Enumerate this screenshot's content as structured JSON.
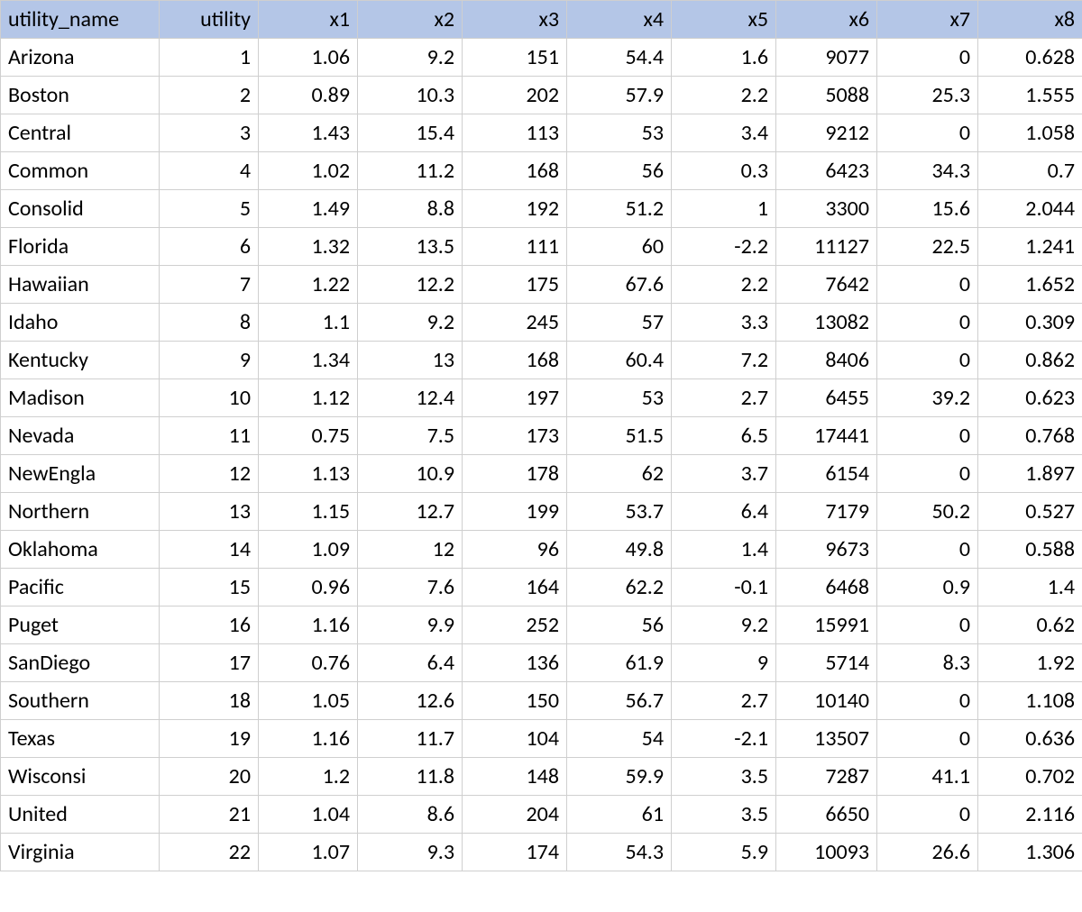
{
  "columns": [
    "utility_name",
    "utility",
    "x1",
    "x2",
    "x3",
    "x4",
    "x5",
    "x6",
    "x7",
    "x8"
  ],
  "rows": [
    {
      "utility_name": "Arizona",
      "utility": "1",
      "x1": "1.06",
      "x2": "9.2",
      "x3": "151",
      "x4": "54.4",
      "x5": "1.6",
      "x6": "9077",
      "x7": "0",
      "x8": "0.628"
    },
    {
      "utility_name": "Boston",
      "utility": "2",
      "x1": "0.89",
      "x2": "10.3",
      "x3": "202",
      "x4": "57.9",
      "x5": "2.2",
      "x6": "5088",
      "x7": "25.3",
      "x8": "1.555"
    },
    {
      "utility_name": "Central",
      "utility": "3",
      "x1": "1.43",
      "x2": "15.4",
      "x3": "113",
      "x4": "53",
      "x5": "3.4",
      "x6": "9212",
      "x7": "0",
      "x8": "1.058"
    },
    {
      "utility_name": "Common",
      "utility": "4",
      "x1": "1.02",
      "x2": "11.2",
      "x3": "168",
      "x4": "56",
      "x5": "0.3",
      "x6": "6423",
      "x7": "34.3",
      "x8": "0.7"
    },
    {
      "utility_name": "Consolid",
      "utility": "5",
      "x1": "1.49",
      "x2": "8.8",
      "x3": "192",
      "x4": "51.2",
      "x5": "1",
      "x6": "3300",
      "x7": "15.6",
      "x8": "2.044"
    },
    {
      "utility_name": "Florida",
      "utility": "6",
      "x1": "1.32",
      "x2": "13.5",
      "x3": "111",
      "x4": "60",
      "x5": "-2.2",
      "x6": "11127",
      "x7": "22.5",
      "x8": "1.241"
    },
    {
      "utility_name": "Hawaiian",
      "utility": "7",
      "x1": "1.22",
      "x2": "12.2",
      "x3": "175",
      "x4": "67.6",
      "x5": "2.2",
      "x6": "7642",
      "x7": "0",
      "x8": "1.652"
    },
    {
      "utility_name": "Idaho",
      "utility": "8",
      "x1": "1.1",
      "x2": "9.2",
      "x3": "245",
      "x4": "57",
      "x5": "3.3",
      "x6": "13082",
      "x7": "0",
      "x8": "0.309"
    },
    {
      "utility_name": "Kentucky",
      "utility": "9",
      "x1": "1.34",
      "x2": "13",
      "x3": "168",
      "x4": "60.4",
      "x5": "7.2",
      "x6": "8406",
      "x7": "0",
      "x8": "0.862"
    },
    {
      "utility_name": "Madison",
      "utility": "10",
      "x1": "1.12",
      "x2": "12.4",
      "x3": "197",
      "x4": "53",
      "x5": "2.7",
      "x6": "6455",
      "x7": "39.2",
      "x8": "0.623"
    },
    {
      "utility_name": "Nevada",
      "utility": "11",
      "x1": "0.75",
      "x2": "7.5",
      "x3": "173",
      "x4": "51.5",
      "x5": "6.5",
      "x6": "17441",
      "x7": "0",
      "x8": "0.768"
    },
    {
      "utility_name": "NewEngla",
      "utility": "12",
      "x1": "1.13",
      "x2": "10.9",
      "x3": "178",
      "x4": "62",
      "x5": "3.7",
      "x6": "6154",
      "x7": "0",
      "x8": "1.897"
    },
    {
      "utility_name": "Northern",
      "utility": "13",
      "x1": "1.15",
      "x2": "12.7",
      "x3": "199",
      "x4": "53.7",
      "x5": "6.4",
      "x6": "7179",
      "x7": "50.2",
      "x8": "0.527"
    },
    {
      "utility_name": "Oklahoma",
      "utility": "14",
      "x1": "1.09",
      "x2": "12",
      "x3": "96",
      "x4": "49.8",
      "x5": "1.4",
      "x6": "9673",
      "x7": "0",
      "x8": "0.588"
    },
    {
      "utility_name": "Pacific",
      "utility": "15",
      "x1": "0.96",
      "x2": "7.6",
      "x3": "164",
      "x4": "62.2",
      "x5": "-0.1",
      "x6": "6468",
      "x7": "0.9",
      "x8": "1.4"
    },
    {
      "utility_name": "Puget",
      "utility": "16",
      "x1": "1.16",
      "x2": "9.9",
      "x3": "252",
      "x4": "56",
      "x5": "9.2",
      "x6": "15991",
      "x7": "0",
      "x8": "0.62"
    },
    {
      "utility_name": "SanDiego",
      "utility": "17",
      "x1": "0.76",
      "x2": "6.4",
      "x3": "136",
      "x4": "61.9",
      "x5": "9",
      "x6": "5714",
      "x7": "8.3",
      "x8": "1.92"
    },
    {
      "utility_name": "Southern",
      "utility": "18",
      "x1": "1.05",
      "x2": "12.6",
      "x3": "150",
      "x4": "56.7",
      "x5": "2.7",
      "x6": "10140",
      "x7": "0",
      "x8": "1.108"
    },
    {
      "utility_name": "Texas",
      "utility": "19",
      "x1": "1.16",
      "x2": "11.7",
      "x3": "104",
      "x4": "54",
      "x5": "-2.1",
      "x6": "13507",
      "x7": "0",
      "x8": "0.636"
    },
    {
      "utility_name": "Wisconsi",
      "utility": "20",
      "x1": "1.2",
      "x2": "11.8",
      "x3": "148",
      "x4": "59.9",
      "x5": "3.5",
      "x6": "7287",
      "x7": "41.1",
      "x8": "0.702"
    },
    {
      "utility_name": "United",
      "utility": "21",
      "x1": "1.04",
      "x2": "8.6",
      "x3": "204",
      "x4": "61",
      "x5": "3.5",
      "x6": "6650",
      "x7": "0",
      "x8": "2.116"
    },
    {
      "utility_name": "Virginia",
      "utility": "22",
      "x1": "1.07",
      "x2": "9.3",
      "x3": "174",
      "x4": "54.3",
      "x5": "5.9",
      "x6": "10093",
      "x7": "26.6",
      "x8": "1.306"
    }
  ]
}
